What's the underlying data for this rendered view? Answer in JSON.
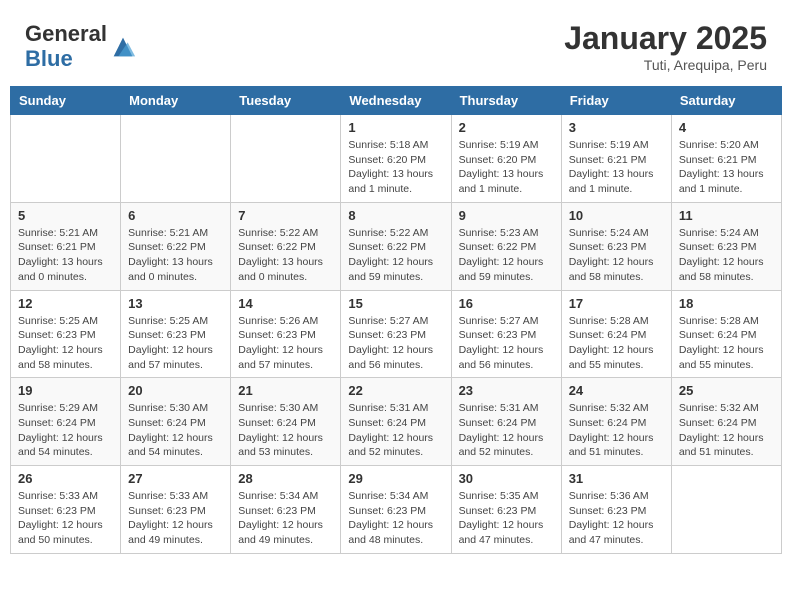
{
  "header": {
    "logo_general": "General",
    "logo_blue": "Blue",
    "month": "January 2025",
    "location": "Tuti, Arequipa, Peru"
  },
  "days_of_week": [
    "Sunday",
    "Monday",
    "Tuesday",
    "Wednesday",
    "Thursday",
    "Friday",
    "Saturday"
  ],
  "weeks": [
    [
      {
        "day": "",
        "info": ""
      },
      {
        "day": "",
        "info": ""
      },
      {
        "day": "",
        "info": ""
      },
      {
        "day": "1",
        "info": "Sunrise: 5:18 AM\nSunset: 6:20 PM\nDaylight: 13 hours and 1 minute."
      },
      {
        "day": "2",
        "info": "Sunrise: 5:19 AM\nSunset: 6:20 PM\nDaylight: 13 hours and 1 minute."
      },
      {
        "day": "3",
        "info": "Sunrise: 5:19 AM\nSunset: 6:21 PM\nDaylight: 13 hours and 1 minute."
      },
      {
        "day": "4",
        "info": "Sunrise: 5:20 AM\nSunset: 6:21 PM\nDaylight: 13 hours and 1 minute."
      }
    ],
    [
      {
        "day": "5",
        "info": "Sunrise: 5:21 AM\nSunset: 6:21 PM\nDaylight: 13 hours and 0 minutes."
      },
      {
        "day": "6",
        "info": "Sunrise: 5:21 AM\nSunset: 6:22 PM\nDaylight: 13 hours and 0 minutes."
      },
      {
        "day": "7",
        "info": "Sunrise: 5:22 AM\nSunset: 6:22 PM\nDaylight: 13 hours and 0 minutes."
      },
      {
        "day": "8",
        "info": "Sunrise: 5:22 AM\nSunset: 6:22 PM\nDaylight: 12 hours and 59 minutes."
      },
      {
        "day": "9",
        "info": "Sunrise: 5:23 AM\nSunset: 6:22 PM\nDaylight: 12 hours and 59 minutes."
      },
      {
        "day": "10",
        "info": "Sunrise: 5:24 AM\nSunset: 6:23 PM\nDaylight: 12 hours and 58 minutes."
      },
      {
        "day": "11",
        "info": "Sunrise: 5:24 AM\nSunset: 6:23 PM\nDaylight: 12 hours and 58 minutes."
      }
    ],
    [
      {
        "day": "12",
        "info": "Sunrise: 5:25 AM\nSunset: 6:23 PM\nDaylight: 12 hours and 58 minutes."
      },
      {
        "day": "13",
        "info": "Sunrise: 5:25 AM\nSunset: 6:23 PM\nDaylight: 12 hours and 57 minutes."
      },
      {
        "day": "14",
        "info": "Sunrise: 5:26 AM\nSunset: 6:23 PM\nDaylight: 12 hours and 57 minutes."
      },
      {
        "day": "15",
        "info": "Sunrise: 5:27 AM\nSunset: 6:23 PM\nDaylight: 12 hours and 56 minutes."
      },
      {
        "day": "16",
        "info": "Sunrise: 5:27 AM\nSunset: 6:23 PM\nDaylight: 12 hours and 56 minutes."
      },
      {
        "day": "17",
        "info": "Sunrise: 5:28 AM\nSunset: 6:24 PM\nDaylight: 12 hours and 55 minutes."
      },
      {
        "day": "18",
        "info": "Sunrise: 5:28 AM\nSunset: 6:24 PM\nDaylight: 12 hours and 55 minutes."
      }
    ],
    [
      {
        "day": "19",
        "info": "Sunrise: 5:29 AM\nSunset: 6:24 PM\nDaylight: 12 hours and 54 minutes."
      },
      {
        "day": "20",
        "info": "Sunrise: 5:30 AM\nSunset: 6:24 PM\nDaylight: 12 hours and 54 minutes."
      },
      {
        "day": "21",
        "info": "Sunrise: 5:30 AM\nSunset: 6:24 PM\nDaylight: 12 hours and 53 minutes."
      },
      {
        "day": "22",
        "info": "Sunrise: 5:31 AM\nSunset: 6:24 PM\nDaylight: 12 hours and 52 minutes."
      },
      {
        "day": "23",
        "info": "Sunrise: 5:31 AM\nSunset: 6:24 PM\nDaylight: 12 hours and 52 minutes."
      },
      {
        "day": "24",
        "info": "Sunrise: 5:32 AM\nSunset: 6:24 PM\nDaylight: 12 hours and 51 minutes."
      },
      {
        "day": "25",
        "info": "Sunrise: 5:32 AM\nSunset: 6:24 PM\nDaylight: 12 hours and 51 minutes."
      }
    ],
    [
      {
        "day": "26",
        "info": "Sunrise: 5:33 AM\nSunset: 6:23 PM\nDaylight: 12 hours and 50 minutes."
      },
      {
        "day": "27",
        "info": "Sunrise: 5:33 AM\nSunset: 6:23 PM\nDaylight: 12 hours and 49 minutes."
      },
      {
        "day": "28",
        "info": "Sunrise: 5:34 AM\nSunset: 6:23 PM\nDaylight: 12 hours and 49 minutes."
      },
      {
        "day": "29",
        "info": "Sunrise: 5:34 AM\nSunset: 6:23 PM\nDaylight: 12 hours and 48 minutes."
      },
      {
        "day": "30",
        "info": "Sunrise: 5:35 AM\nSunset: 6:23 PM\nDaylight: 12 hours and 47 minutes."
      },
      {
        "day": "31",
        "info": "Sunrise: 5:36 AM\nSunset: 6:23 PM\nDaylight: 12 hours and 47 minutes."
      },
      {
        "day": "",
        "info": ""
      }
    ]
  ]
}
